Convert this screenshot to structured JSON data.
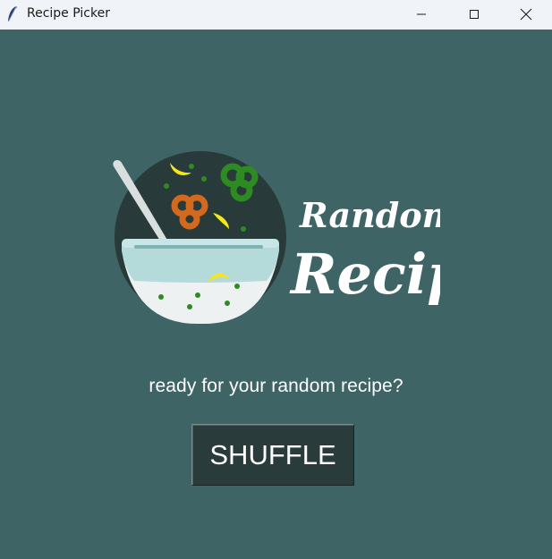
{
  "window": {
    "title": "Recipe Picker",
    "app_icon": "feather-icon",
    "controls": {
      "minimize_icon": "minimize-icon",
      "maximize_icon": "maximize-icon",
      "close_icon": "close-icon"
    }
  },
  "logo": {
    "line1": "Random",
    "line2": "Recipe",
    "icon": "salad-bowl-icon"
  },
  "main": {
    "prompt": "ready for your random recipe?",
    "shuffle_label": "SHUFFLE"
  },
  "colors": {
    "background": "#3e6466",
    "titlebar": "#f0f4f9",
    "button_bg": "#2a3b3b",
    "text": "#ffffff",
    "bowl_circle": "#283a3a",
    "pepper_green": "#2e8b22",
    "pepper_orange": "#d2691e",
    "lemon": "#f5e61e"
  }
}
